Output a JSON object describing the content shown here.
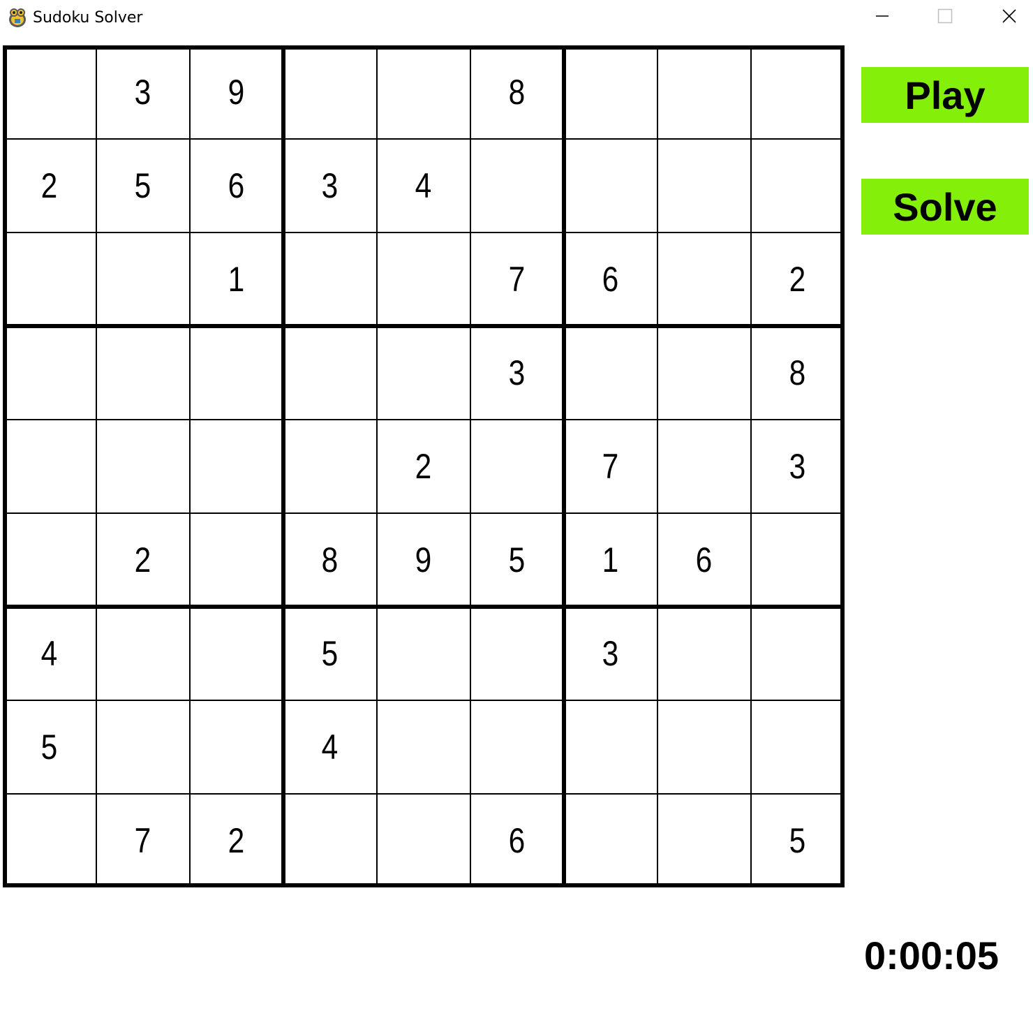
{
  "window": {
    "title": "Sudoku Solver",
    "icon": "pygame-snake-icon",
    "controls": [
      "minimize-icon",
      "maximize-icon",
      "close-icon"
    ]
  },
  "board": {
    "rows": [
      [
        "",
        "3",
        "9",
        "",
        "",
        "8",
        "",
        "",
        ""
      ],
      [
        "2",
        "5",
        "6",
        "3",
        "4",
        "",
        "",
        "",
        ""
      ],
      [
        "",
        "",
        "1",
        "",
        "",
        "7",
        "6",
        "",
        "2"
      ],
      [
        "",
        "",
        "",
        "",
        "",
        "3",
        "",
        "",
        "8"
      ],
      [
        "",
        "",
        "",
        "",
        "2",
        "",
        "7",
        "",
        "3"
      ],
      [
        "",
        "2",
        "",
        "8",
        "9",
        "5",
        "1",
        "6",
        ""
      ],
      [
        "4",
        "",
        "",
        "5",
        "",
        "",
        "3",
        "",
        ""
      ],
      [
        "5",
        "",
        "",
        "4",
        "",
        "",
        "",
        "",
        ""
      ],
      [
        "",
        "7",
        "2",
        "",
        "",
        "6",
        "",
        "",
        "5"
      ]
    ]
  },
  "buttons": {
    "play_label": "Play",
    "solve_label": "Solve",
    "color": "#84f00a"
  },
  "timer": {
    "text": "0:00:05"
  }
}
